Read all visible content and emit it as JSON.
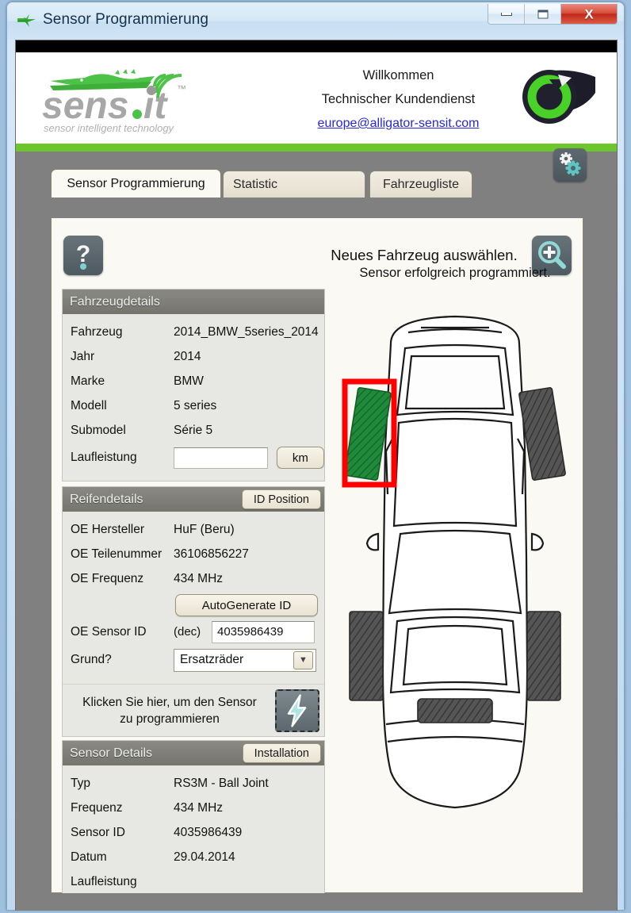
{
  "window": {
    "title": "Sensor Programmierung",
    "icon": "app-logo-icon",
    "minimize_label": "Minimize",
    "maximize_label": "Maximize",
    "close_label": "X"
  },
  "header": {
    "logo_text": "sens.it",
    "logo_tagline": "sensor intelligent technology",
    "welcome_line1": "Willkommen",
    "welcome_line2": "Technischer Kundendienst",
    "email": "europe@alligator-sensit.com",
    "brand_green": "#6dc72c"
  },
  "tabs": [
    {
      "label": "Sensor Programmierung",
      "active": true
    },
    {
      "label": "Statistic",
      "active": false
    },
    {
      "label": "Fahrzeugliste",
      "active": false
    }
  ],
  "toolbar": {
    "gear_icon": "gear-icon",
    "help_icon": "question-mark-icon",
    "zoom_icon": "magnifier-plus-icon"
  },
  "content": {
    "headline": "Neues Fahrzeug auswählen."
  },
  "vehicle_details": {
    "title": "Fahrzeugdetails",
    "rows": [
      {
        "label": "Fahrzeug",
        "value": "2014_BMW_5series_2014"
      },
      {
        "label": "Jahr",
        "value": "2014"
      },
      {
        "label": "Marke",
        "value": "BMW"
      },
      {
        "label": "Modell",
        "value": "5 series"
      },
      {
        "label": "Submodel",
        "value": "Série 5"
      }
    ],
    "mileage_label": "Laufleistung",
    "mileage_value": "",
    "mileage_unit_button": "km"
  },
  "tire_details": {
    "title": "Reifendetails",
    "id_position_button": "ID Position",
    "rows": [
      {
        "label": "OE Hersteller",
        "value": "HuF (Beru)"
      },
      {
        "label": "OE Teilenummer",
        "value": "36106856227"
      },
      {
        "label": "OE Frequenz",
        "value": "434 MHz"
      }
    ],
    "autogenerate_button": "AutoGenerate ID",
    "sensor_id_label": "OE Sensor ID",
    "sensor_id_unit": "(dec)",
    "sensor_id_value": "4035986439",
    "reason_label": "Grund?",
    "reason_selected": "Ersatzräder",
    "reason_options": [
      "Ersatzräder"
    ],
    "program_text_line1": "Klicken Sie hier, um den Sensor",
    "program_text_line2": "zu programmieren",
    "program_icon": "lightning-bolt-icon"
  },
  "sensor_details": {
    "title": "Sensor Details",
    "installation_button": "Installation",
    "rows": [
      {
        "label": "Typ",
        "value": "RS3M - Ball Joint"
      },
      {
        "label": "Frequenz",
        "value": "434 MHz"
      },
      {
        "label": "Sensor ID",
        "value": "4035986439"
      },
      {
        "label": "Datum",
        "value": "29.04.2014"
      },
      {
        "label": "Laufleistung",
        "value": ""
      }
    ]
  },
  "car_diagram": {
    "status": "Sensor erfolgreich programmiert.",
    "highlighted_wheel": "front-left",
    "highlight_color": "#ff0000",
    "active_tire_color": "#1f8b3a",
    "inactive_tire_color": "#555555",
    "wheels": [
      {
        "position": "front-left",
        "state": "programmed"
      },
      {
        "position": "front-right",
        "state": "idle"
      },
      {
        "position": "rear-left",
        "state": "idle"
      },
      {
        "position": "rear-right",
        "state": "idle"
      }
    ]
  }
}
